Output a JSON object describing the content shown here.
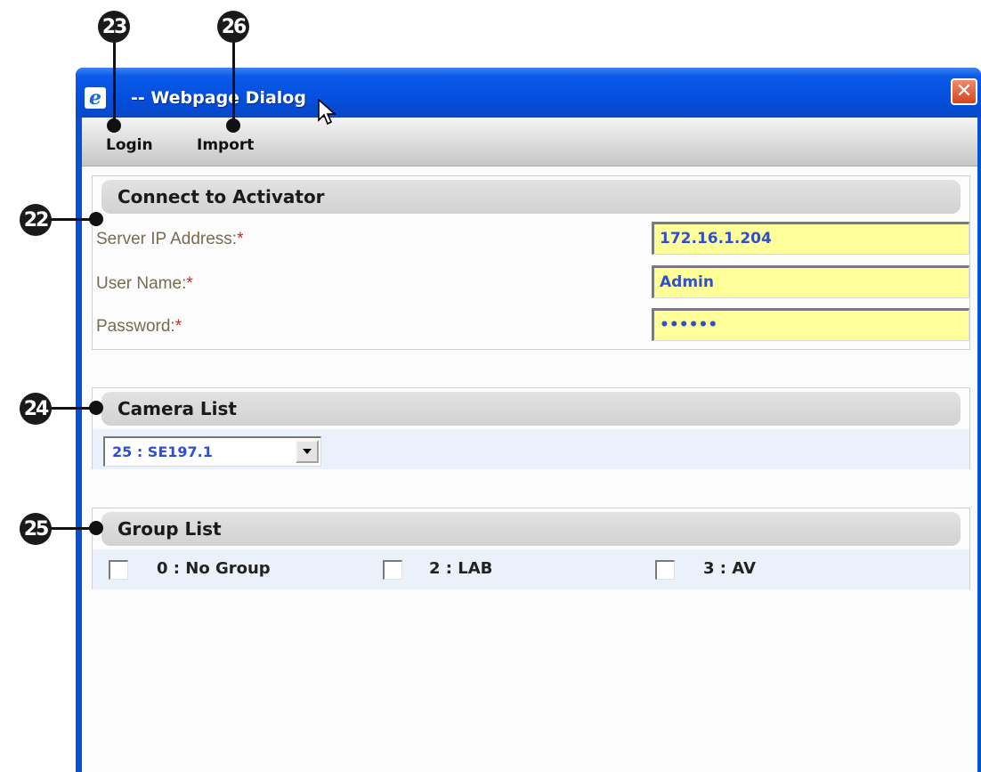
{
  "callouts": [
    "22",
    "23",
    "24",
    "25",
    "26"
  ],
  "window": {
    "title": "-- Webpage Dialog",
    "icon": "ie-icon",
    "close_icon": "close-icon"
  },
  "menu": {
    "items": [
      {
        "label": "Login"
      },
      {
        "label": "Import"
      }
    ]
  },
  "connect": {
    "header": "Connect to Activator",
    "required_mark": "*",
    "fields": [
      {
        "label": "Server IP Address:",
        "value": "172.16.1.204"
      },
      {
        "label": "User Name:",
        "value": "Admin"
      },
      {
        "label": "Password:",
        "value": "••••••"
      }
    ]
  },
  "camera": {
    "header": "Camera List",
    "selected": "25 : SE197.1"
  },
  "groups": {
    "header": "Group List",
    "items": [
      {
        "label": "0 : No Group",
        "checked": false
      },
      {
        "label": "2 : LAB",
        "checked": false
      },
      {
        "label": "3 : AV",
        "checked": false
      }
    ]
  },
  "colors": {
    "titlebar": "#0550e0",
    "input_bg": "#ffff99",
    "input_text": "#2f4fd0",
    "required": "#e02020"
  }
}
